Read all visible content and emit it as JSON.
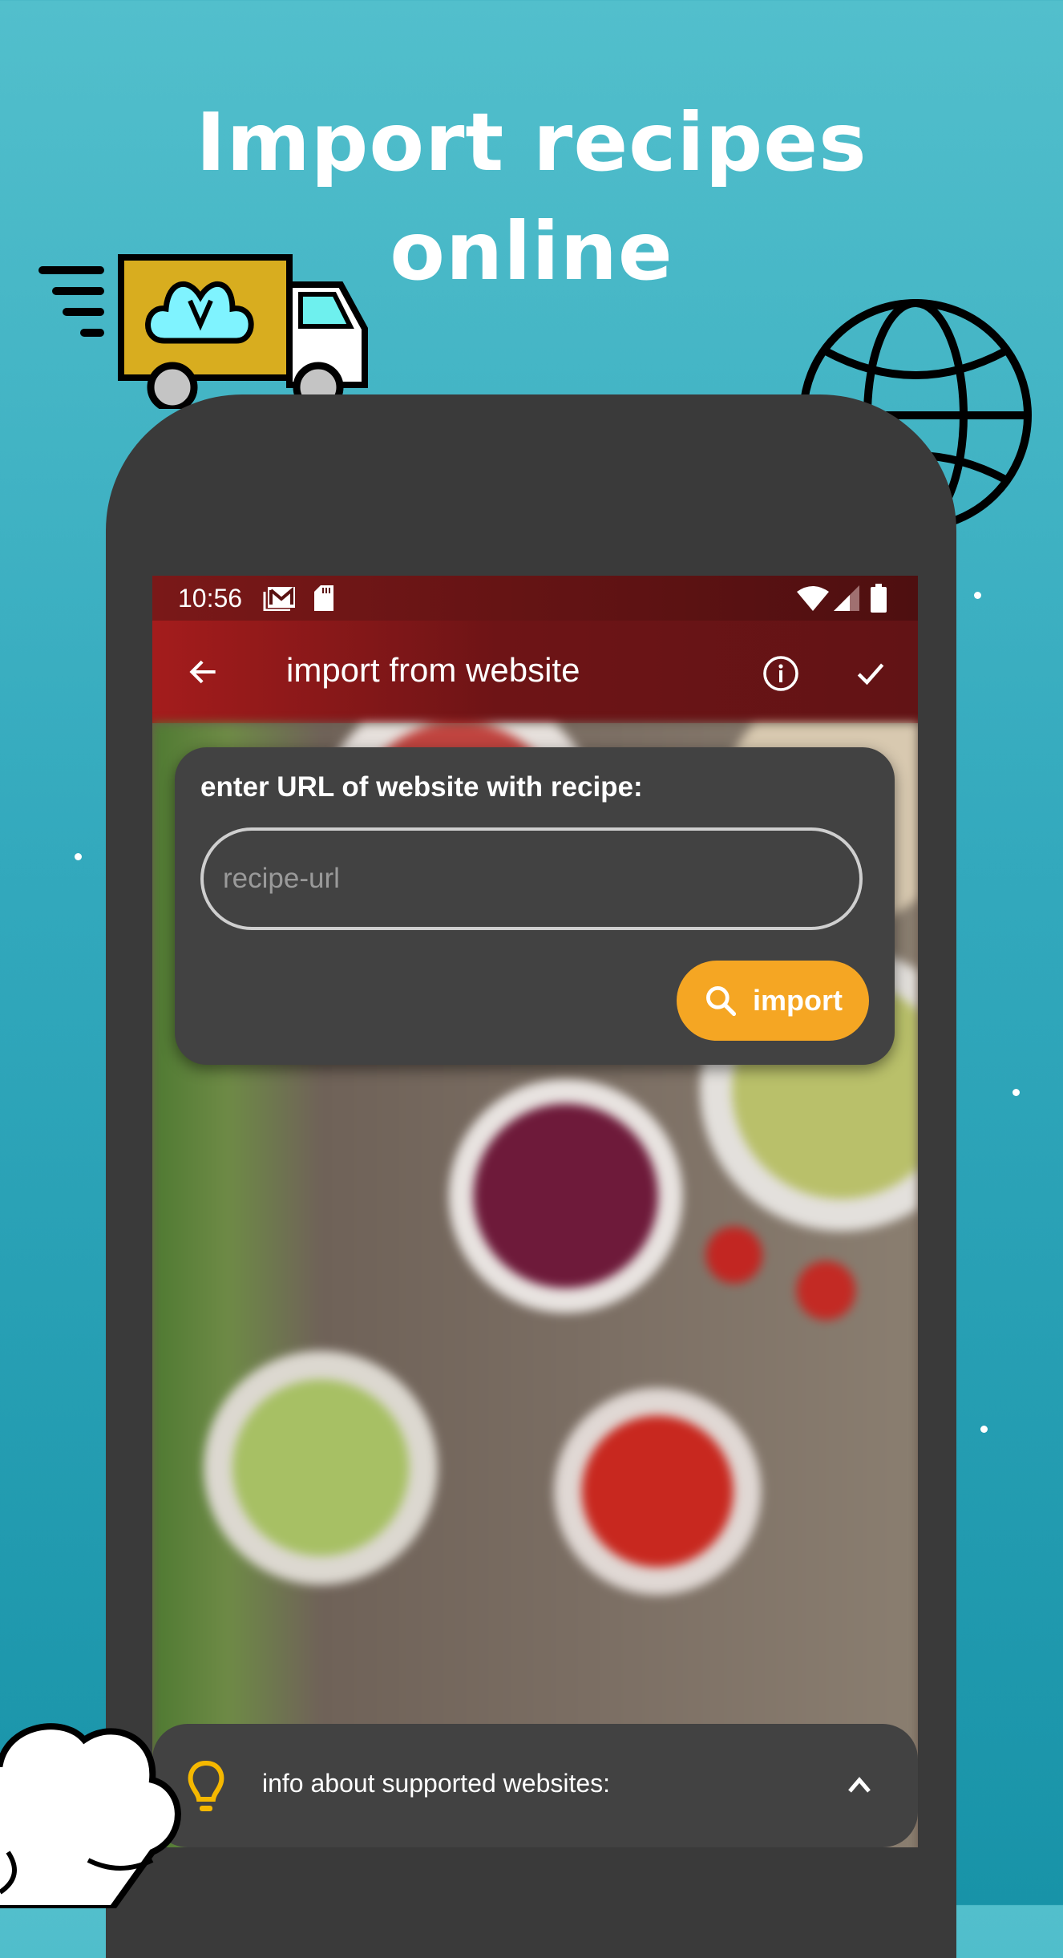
{
  "promo": {
    "headline_line1": "Import recipes",
    "headline_line2": "online",
    "background_color": "#33a9bd",
    "illustrations": [
      "delivery-truck-icon",
      "globe-icon",
      "chef-hat-icon"
    ]
  },
  "statusbar": {
    "time": "10:56",
    "left_icons": [
      "gmail-icon",
      "sd-card-icon"
    ],
    "right_icons": [
      "wifi-icon",
      "cell-signal-icon",
      "battery-icon"
    ]
  },
  "appbar": {
    "title": "import from website",
    "back_icon": "arrow-left-icon",
    "actions": [
      "info-icon",
      "check-icon"
    ],
    "color": "#8b1a1a"
  },
  "import_card": {
    "label": "enter URL of website with recipe:",
    "url_input": {
      "value": "",
      "placeholder": "recipe-url"
    },
    "import_button": {
      "label": "import",
      "icon": "search-icon",
      "color": "#f5a623"
    }
  },
  "info_panel": {
    "text": "info about supported websites:",
    "icon": "lightbulb-icon",
    "icon_color": "#f5b800",
    "toggle_icon": "chevron-up-icon"
  }
}
